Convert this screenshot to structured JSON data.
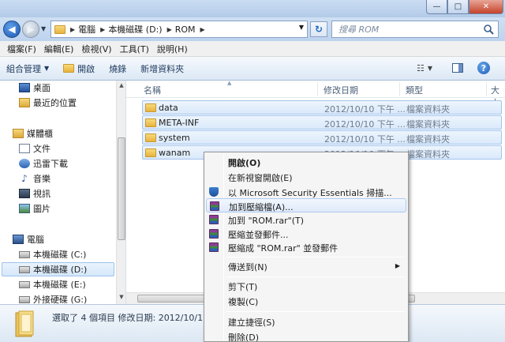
{
  "window": {
    "controls": {
      "minimize": "—",
      "maximize": "□",
      "close": "✕"
    }
  },
  "address": {
    "crumbs": [
      "電腦",
      "本機磁碟 (D:)",
      "ROM"
    ],
    "search_placeholder": "搜尋 ROM"
  },
  "menubar": {
    "items": [
      "檔案(F)",
      "編輯(E)",
      "檢視(V)",
      "工具(T)",
      "說明(H)"
    ]
  },
  "toolbar": {
    "organize_label": "組合管理",
    "open_label": "開啟",
    "burn_label": "燒錄",
    "new_folder_label": "新增資料夾"
  },
  "navpane": {
    "favorites": [
      "桌面",
      "最近的位置"
    ],
    "libraries_header": "媒體櫃",
    "libraries": [
      "文件",
      "迅雷下載",
      "音樂",
      "視訊",
      "圖片"
    ],
    "computer_header": "電腦",
    "drives": [
      "本機磁碟 (C:)",
      "本機磁碟 (D:)",
      "本機磁碟 (E:)",
      "外接硬碟 (G:)"
    ],
    "selected": "本機磁碟 (D:)"
  },
  "filelist": {
    "columns": {
      "name": "名稱",
      "date": "修改日期",
      "type": "類型",
      "size": "大小"
    },
    "rows": [
      {
        "name": "data",
        "date": "2012/10/10 下午 ...",
        "type": "檔案資料夾"
      },
      {
        "name": "META-INF",
        "date": "2012/10/10 下午 ...",
        "type": "檔案資料夾"
      },
      {
        "name": "system",
        "date": "2012/10/10 下午 ...",
        "type": "檔案資料夾"
      },
      {
        "name": "wanam",
        "date": "2012/10/10 下午 ...",
        "type": "檔案資料夾"
      }
    ]
  },
  "details": {
    "text": "選取了 4 個項目  修改日期: 2012/10/1"
  },
  "context_menu": {
    "items": [
      {
        "label": "開啟(O)",
        "bold": true
      },
      {
        "label": "在新視窗開啟(E)"
      },
      {
        "label": "以 Microsoft Security Essentials 掃描...",
        "icon": "mse-shield-icon"
      },
      {
        "label": "加到壓縮檔(A)...",
        "icon": "winrar-icon",
        "hover": true
      },
      {
        "label": "加到 \"ROM.rar\"(T)",
        "icon": "winrar-icon"
      },
      {
        "label": "壓縮並發郵件...",
        "icon": "winrar-icon"
      },
      {
        "label": "壓縮成 \"ROM.rar\" 並發郵件",
        "icon": "winrar-icon"
      },
      {
        "label": "傳送到(N)",
        "submenu": true
      },
      {
        "label": "剪下(T)"
      },
      {
        "label": "複製(C)"
      },
      {
        "label": "建立捷徑(S)"
      },
      {
        "label": "刪除(D)"
      }
    ]
  },
  "colors": {
    "selection_fill": "#d9e9fa",
    "selection_border": "#a4c5ec",
    "chrome_blue": "#bdd3ee"
  }
}
